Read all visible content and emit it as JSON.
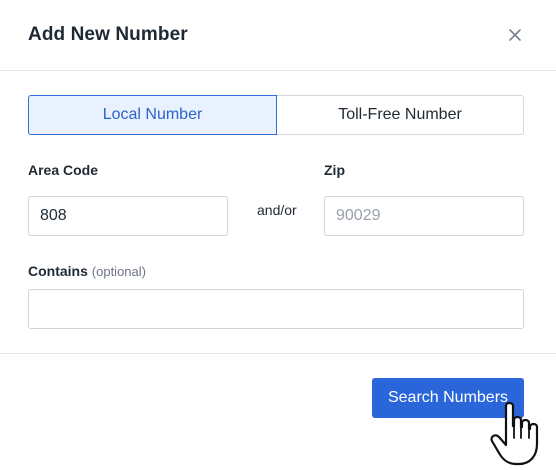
{
  "dialog": {
    "title": "Add New Number",
    "close_icon": "close-icon"
  },
  "tabs": [
    {
      "label": "Local Number",
      "active": true
    },
    {
      "label": "Toll-Free Number",
      "active": false
    }
  ],
  "fields": {
    "area_code": {
      "label": "Area Code",
      "value": "808",
      "placeholder": ""
    },
    "separator": "and/or",
    "zip": {
      "label": "Zip",
      "value": "",
      "placeholder": "90029"
    },
    "contains": {
      "label": "Contains",
      "hint": "(optional)",
      "value": "",
      "placeholder": ""
    }
  },
  "footer": {
    "search_label": "Search Numbers"
  },
  "cursor_icon": "hand-pointer-icon",
  "colors": {
    "accent": "#2a66d9",
    "active_tab_bg": "#e8f1fd",
    "active_tab_border": "#2f6fdb",
    "border": "#d3d7dc"
  }
}
